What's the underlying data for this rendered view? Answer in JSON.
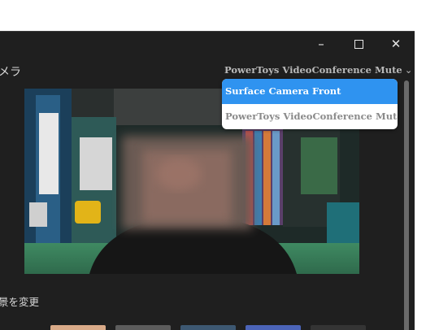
{
  "window": {
    "title_partial": "メラ",
    "controls": {
      "minimize": "–",
      "maximize": "",
      "close": "✕"
    }
  },
  "camera": {
    "selected_label": "PowerToys VideoConference Mute",
    "chevron": "⌄"
  },
  "dropdown": {
    "options": [
      {
        "label": "Surface Camera Front",
        "selected": true
      },
      {
        "label": "PowerToys VideoConference Mute",
        "selected": false
      }
    ]
  },
  "background": {
    "label": "景を変更",
    "thumbnails": [
      {
        "color": "#d9aa88"
      },
      {
        "color": "#5c5c5c"
      },
      {
        "color": "#3d5872"
      },
      {
        "color": "#4b64b8"
      },
      {
        "color": "#343434"
      }
    ]
  },
  "colors": {
    "window_bg": "#1f1f1f",
    "accent": "#2f93f0",
    "dropdown_text_inactive": "#8a8a8a"
  }
}
